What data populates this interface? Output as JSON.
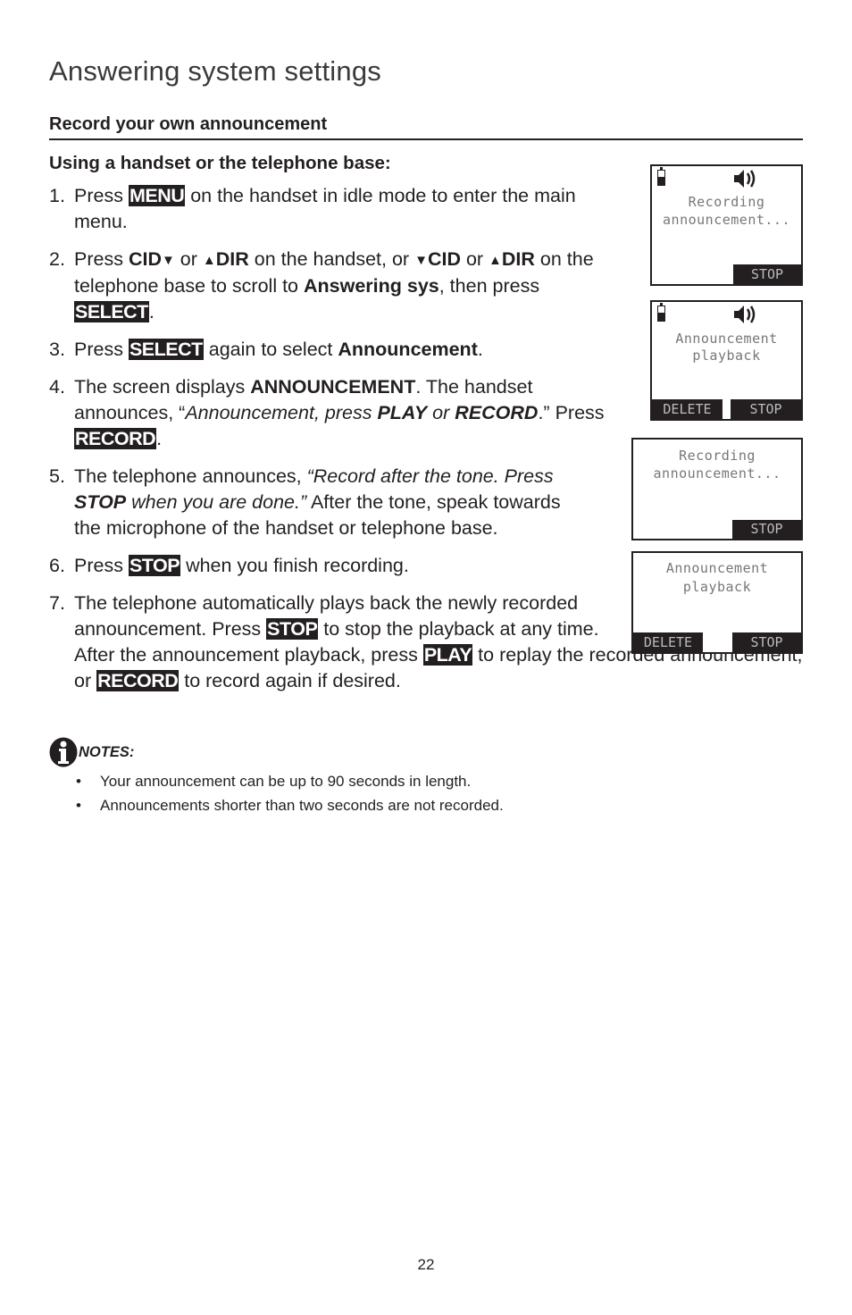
{
  "page": {
    "title": "Answering system settings",
    "section_heading": "Record your own announcement",
    "subheading": "Using a handset or the telephone base:",
    "page_number": "22"
  },
  "steps": [
    {
      "num": "1.",
      "parts": [
        "Press ",
        "MENU",
        " on the handset in idle mode to enter the main menu."
      ]
    },
    {
      "num": "2.",
      "parts": [
        "Press ",
        "CID",
        "▼",
        " or ",
        "▲",
        "DIR",
        " on the handset, or ",
        "▼",
        "CID",
        " or ",
        "▲",
        "DIR",
        " on the telephone base to scroll to ",
        "Answering sys",
        ", then press ",
        "SELECT",
        "."
      ]
    },
    {
      "num": "3.",
      "parts": [
        "Press ",
        "SELECT",
        " again to select ",
        "Announcement",
        "."
      ]
    },
    {
      "num": "4.",
      "parts": [
        "The screen displays ",
        "ANNOUNCEMENT",
        ". The handset announces, “",
        "Announcement, press ",
        "PLAY",
        " or ",
        "RECORD",
        ".”",
        " Press ",
        "RECORD",
        "."
      ]
    },
    {
      "num": "5.",
      "parts": [
        "The telephone announces, ",
        "“Record after the tone. Press ",
        "STOP",
        " when you are done.”",
        " After the tone, speak towards the microphone of the handset or telephone base."
      ]
    },
    {
      "num": "6.",
      "parts": [
        "Press ",
        "STOP",
        " when you finish recording."
      ]
    },
    {
      "num": "7.",
      "parts": [
        "The telephone automatically plays back the newly recorded announcement. Press ",
        "STOP",
        " to stop the playback at any time. After the announcement playback, press ",
        "PLAY",
        " to replay the recorded announcement, or ",
        "RECORD",
        " to record again if desired."
      ]
    }
  ],
  "screens": [
    {
      "line1": "Recording",
      "line2": "announcement...",
      "softkey_right": "STOP",
      "softkey_left": ""
    },
    {
      "line1": "Announcement",
      "line2": "playback",
      "softkey_right": "STOP",
      "softkey_left": "DELETE"
    },
    {
      "line1": "Recording",
      "line2": "announcement...",
      "softkey_right": "STOP",
      "softkey_left": ""
    },
    {
      "line1": "Announcement",
      "line2": "playback",
      "softkey_right": "STOP",
      "softkey_left": "DELETE"
    }
  ],
  "notes": {
    "label": "NOTES:",
    "items": [
      "Your announcement can be up to 90 seconds in length.",
      "Announcements shorter than two seconds are not recorded."
    ]
  }
}
